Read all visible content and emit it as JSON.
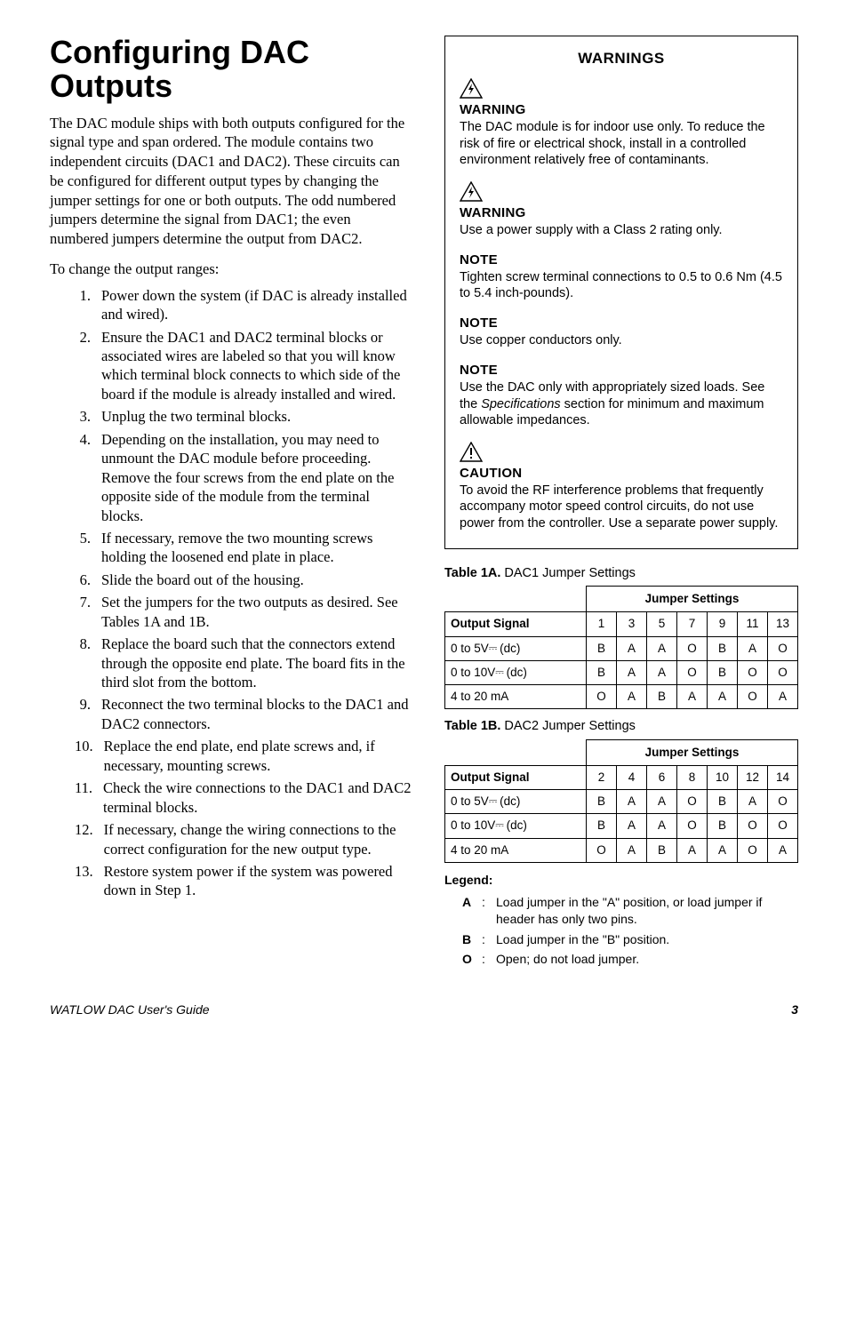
{
  "title": "Configuring DAC Outputs",
  "intro1": "The DAC module ships with both outputs configured for the signal type and span ordered. The module contains two independent circuits (DAC1 and DAC2). These circuits can be configured for different output types by changing the jumper settings for one or both outputs. The odd numbered jumpers determine the signal from DAC1; the even numbered jumpers determine the output from DAC2.",
  "intro2": "To change the output ranges:",
  "steps": [
    "Power down the system (if DAC is already installed and wired).",
    "Ensure the DAC1 and DAC2 terminal blocks or associated wires are labeled so that you will know which terminal block connects to which side of the board if the module is already installed and wired.",
    "Unplug the two terminal blocks.",
    "Depending on the installation, you may need to unmount the DAC module before proceeding. Remove the four screws from the end plate on the opposite side of the module from the terminal blocks.",
    "If necessary, remove the two mounting screws holding the loosened end plate in place.",
    "Slide the board out of the housing.",
    "Set the jumpers for the two outputs as desired. See Tables 1A and 1B.",
    "Replace the board such that the connectors extend through the opposite end plate. The board fits in the third slot from the bottom.",
    "Reconnect the two terminal blocks to the DAC1 and DAC2 connectors.",
    "Replace the end plate, end plate screws and, if necessary, mounting screws.",
    "Check the wire connections to the DAC1 and DAC2 terminal blocks.",
    "If necessary, change the wiring connections to the correct configuration for the new output type.",
    "Restore system power if the system was powered down in Step 1."
  ],
  "warn_panel_title": "WARNINGS",
  "warn_blocks": [
    {
      "icon": "shock",
      "head": "WARNING",
      "body": "The DAC module is for indoor use only. To reduce the risk of fire or electrical shock, install in a controlled environment relatively free of contaminants."
    },
    {
      "icon": "shock",
      "head": "WARNING",
      "body": "Use a power supply with a Class 2 rating only."
    },
    {
      "icon": "",
      "head": "NOTE",
      "body": "Tighten screw terminal connections to 0.5 to 0.6 Nm (4.5 to 5.4 inch-pounds)."
    },
    {
      "icon": "",
      "head": "NOTE",
      "body": "Use copper conductors only."
    },
    {
      "icon": "",
      "head": "NOTE",
      "body": "Use the DAC only with appropriately sized loads. See the Specifications section for minimum and maximum allowable impedances."
    },
    {
      "icon": "caution",
      "head": "CAUTION",
      "body": "To avoid the RF interference problems that frequently accompany motor speed control circuits, do not use power from the controller. Use a separate power supply."
    }
  ],
  "table1a_title_prefix": "Table 1A.",
  "table1a_title_rest": " DAC1 Jumper Settings",
  "table1b_title_prefix": "Table 1B.",
  "table1b_title_rest": " DAC2 Jumper Settings",
  "table_group_hdr": "Jumper Settings",
  "output_signal_label": "Output Signal",
  "table1a": {
    "cols": [
      "1",
      "3",
      "5",
      "7",
      "9",
      "11",
      "13"
    ],
    "rows": [
      {
        "label": "0 to 5V⎓ (dc)",
        "vals": [
          "B",
          "A",
          "A",
          "O",
          "B",
          "A",
          "O"
        ]
      },
      {
        "label": "0 to 10V⎓ (dc)",
        "vals": [
          "B",
          "A",
          "A",
          "O",
          "B",
          "O",
          "O"
        ]
      },
      {
        "label": "4 to 20 mA",
        "vals": [
          "O",
          "A",
          "B",
          "A",
          "A",
          "O",
          "A"
        ]
      }
    ]
  },
  "table1b": {
    "cols": [
      "2",
      "4",
      "6",
      "8",
      "10",
      "12",
      "14"
    ],
    "rows": [
      {
        "label": "0 to 5V⎓ (dc)",
        "vals": [
          "B",
          "A",
          "A",
          "O",
          "B",
          "A",
          "O"
        ]
      },
      {
        "label": "0 to 10V⎓ (dc)",
        "vals": [
          "B",
          "A",
          "A",
          "O",
          "B",
          "O",
          "O"
        ]
      },
      {
        "label": "4 to 20 mA",
        "vals": [
          "O",
          "A",
          "B",
          "A",
          "A",
          "O",
          "A"
        ]
      }
    ]
  },
  "legend_title": "Legend:",
  "legend": [
    {
      "k": "A",
      "v": "Load jumper in the \"A\" position, or load jumper if header has only two pins."
    },
    {
      "k": "B",
      "v": "Load jumper in the \"B\" position."
    },
    {
      "k": "O",
      "v": "Open; do not load jumper."
    }
  ],
  "footer_left": "WATLOW DAC User's Guide",
  "footer_right": "3",
  "chart_data": [
    {
      "type": "table",
      "title": "Table 1A. DAC1 Jumper Settings",
      "columns": [
        "Output Signal",
        "1",
        "3",
        "5",
        "7",
        "9",
        "11",
        "13"
      ],
      "rows": [
        [
          "0 to 5V dc",
          "B",
          "A",
          "A",
          "O",
          "B",
          "A",
          "O"
        ],
        [
          "0 to 10V dc",
          "B",
          "A",
          "A",
          "O",
          "B",
          "O",
          "O"
        ],
        [
          "4 to 20 mA",
          "O",
          "A",
          "B",
          "A",
          "A",
          "O",
          "A"
        ]
      ]
    },
    {
      "type": "table",
      "title": "Table 1B. DAC2 Jumper Settings",
      "columns": [
        "Output Signal",
        "2",
        "4",
        "6",
        "8",
        "10",
        "12",
        "14"
      ],
      "rows": [
        [
          "0 to 5V dc",
          "B",
          "A",
          "A",
          "O",
          "B",
          "A",
          "O"
        ],
        [
          "0 to 10V dc",
          "B",
          "A",
          "A",
          "O",
          "B",
          "O",
          "O"
        ],
        [
          "4 to 20 mA",
          "O",
          "A",
          "B",
          "A",
          "A",
          "O",
          "A"
        ]
      ]
    }
  ]
}
